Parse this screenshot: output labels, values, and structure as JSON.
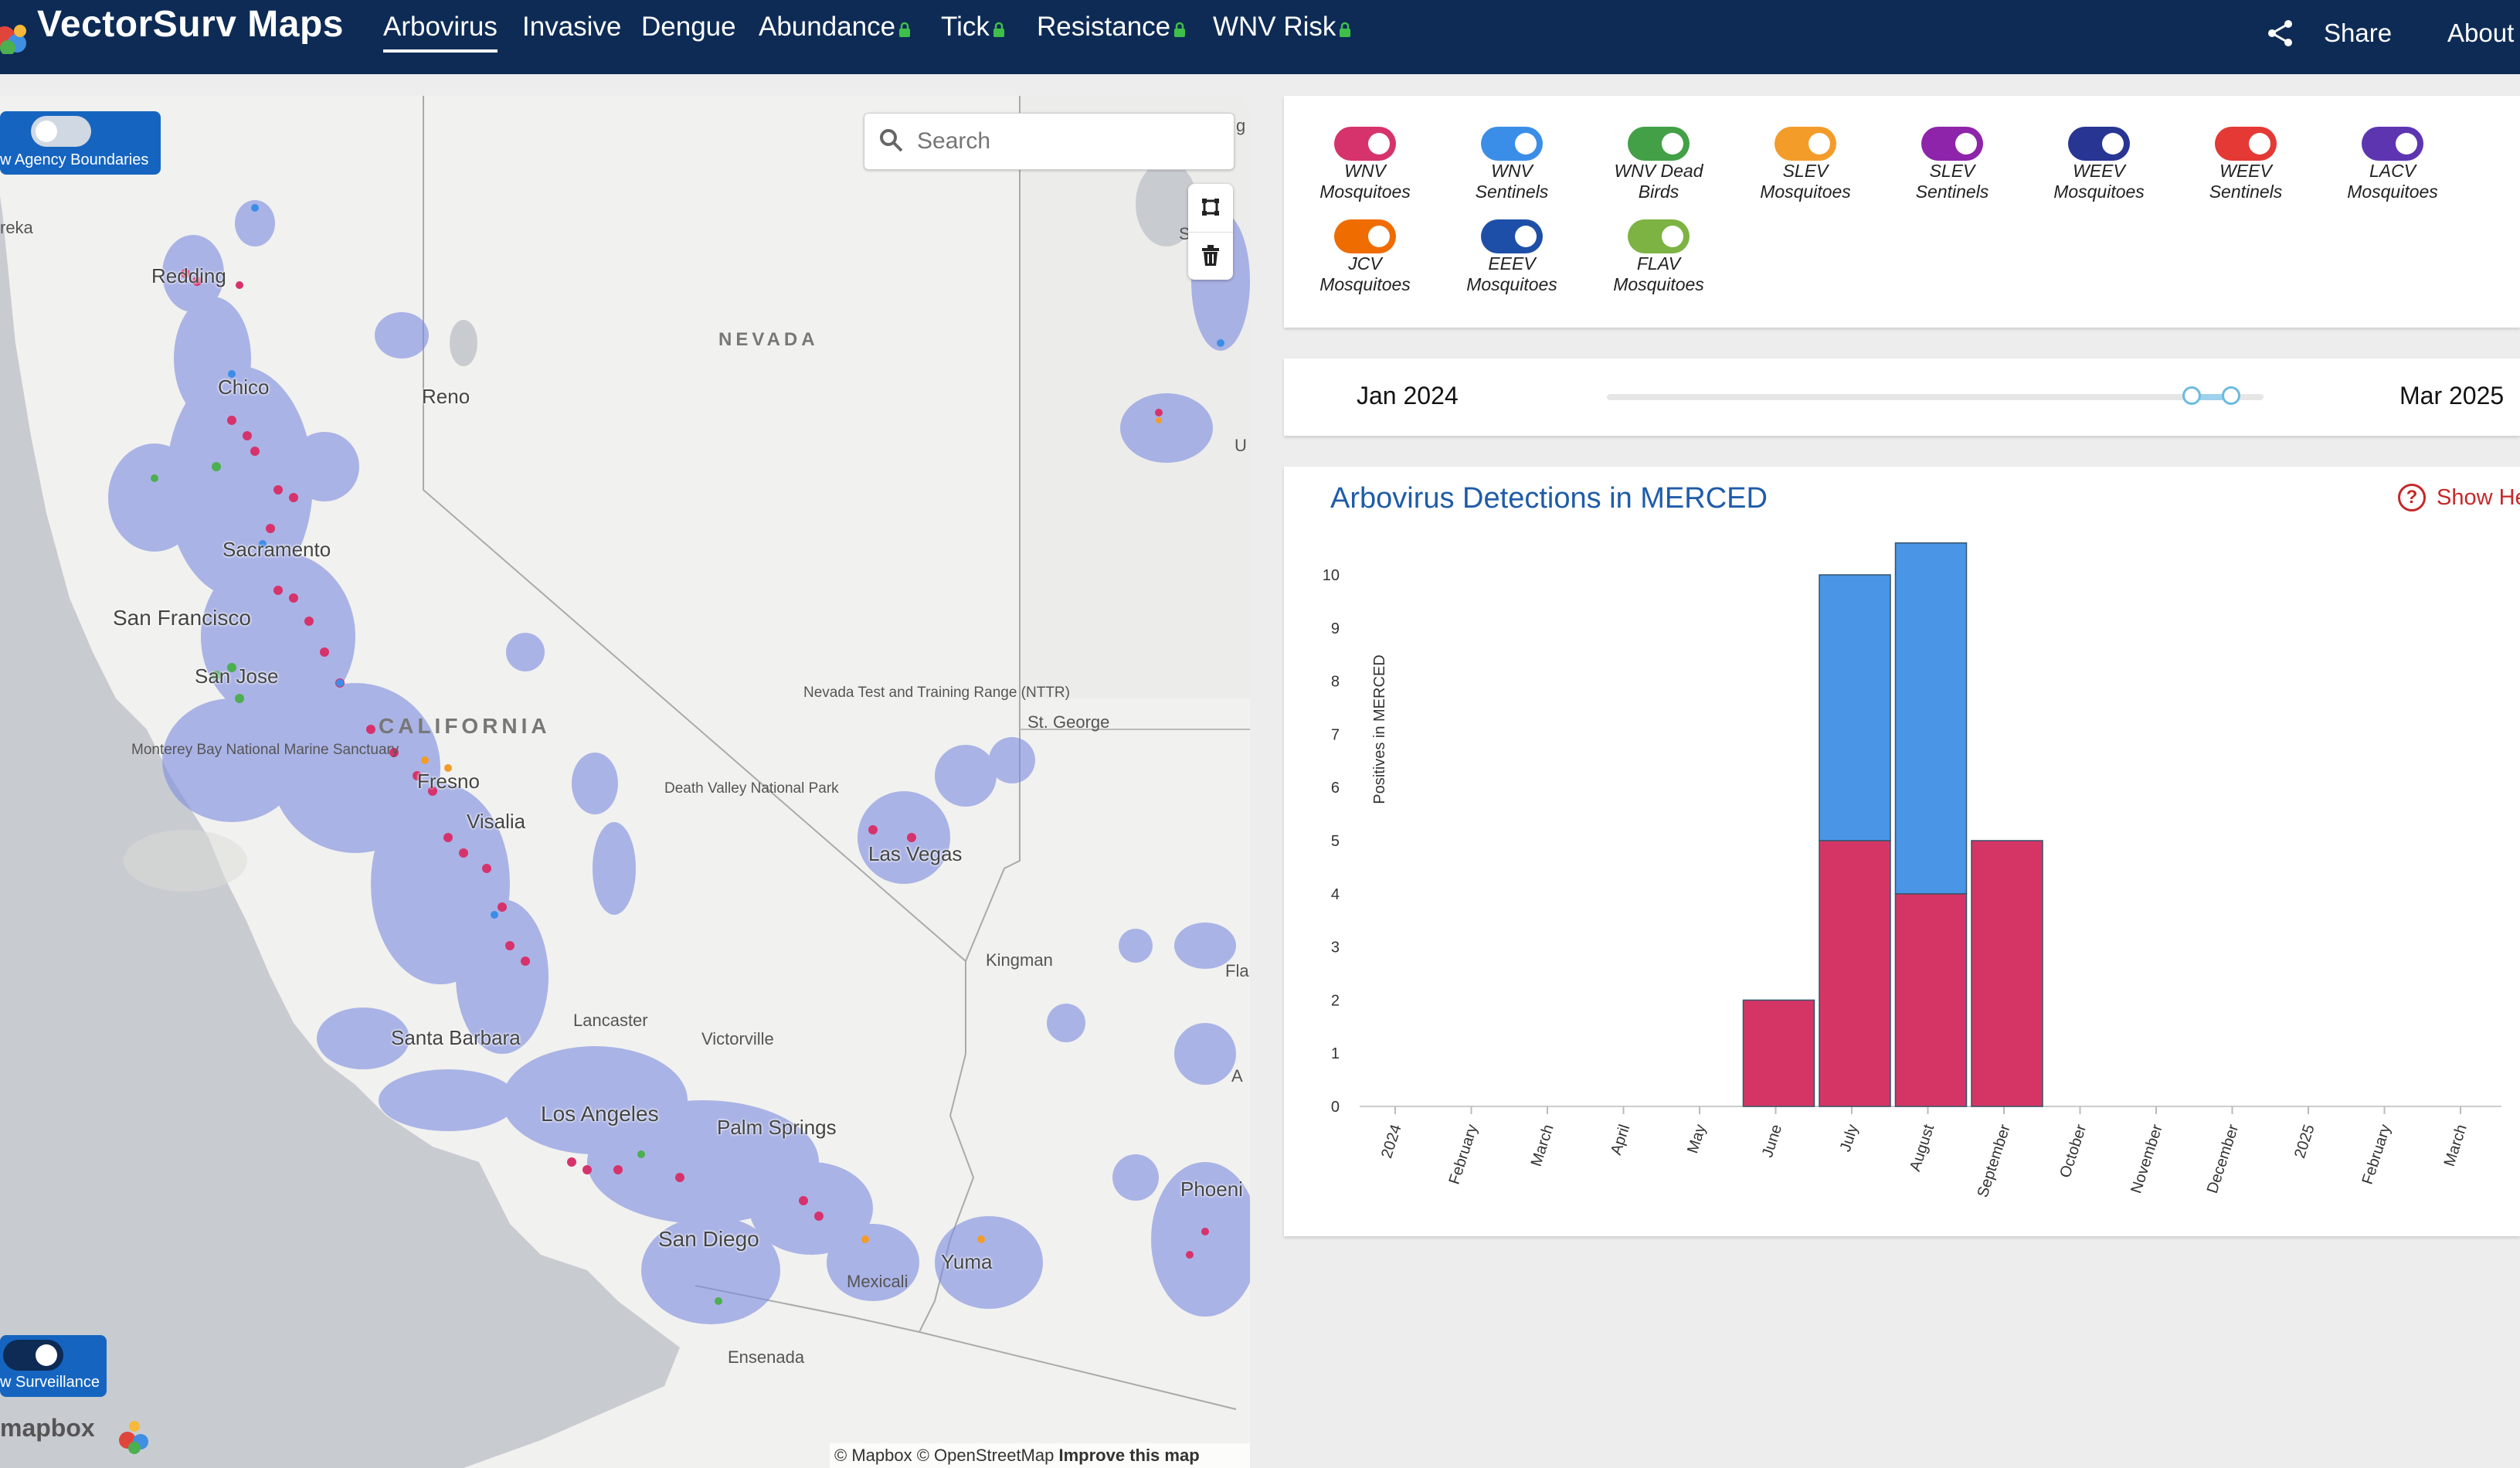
{
  "app": {
    "brand": "VectorSurv Maps",
    "nav": [
      {
        "label": "Arbovirus",
        "active": true,
        "locked": false
      },
      {
        "label": "Invasive",
        "active": false,
        "locked": false
      },
      {
        "label": "Dengue",
        "active": false,
        "locked": false
      },
      {
        "label": "Abundance",
        "active": false,
        "locked": true
      },
      {
        "label": "Tick",
        "active": false,
        "locked": true
      },
      {
        "label": "Resistance",
        "active": false,
        "locked": true
      },
      {
        "label": "WNV Risk",
        "active": false,
        "locked": true
      }
    ],
    "share_label": "Share",
    "about_label": "About",
    "colors": {
      "nav_bg": "#0d2b55",
      "accent": "#1565c0",
      "lock": "#3fbf4a"
    }
  },
  "map": {
    "search_placeholder": "Search",
    "toggle_top_label": "w Agency Boundaries",
    "toggle_bottom_label": "w Surveillance",
    "attribution": {
      "mapbox": "© Mapbox",
      "osm": "© OpenStreetMap",
      "improve": "Improve this map"
    },
    "mapbox_logo": "mapbox",
    "labels": {
      "eureka": "reka",
      "redding": "Redding",
      "chico": "Chico",
      "reno": "Reno",
      "nevada": "NEVADA",
      "sacramento": "Sacramento",
      "san_francisco": "San Francisco",
      "san_jose": "San Jose",
      "monterey": "Monterey Bay National Marine Sanctuary",
      "california": "CALIFORNIA",
      "fresno": "Fresno",
      "visalia": "Visalia",
      "nttr": "Nevada Test and Training Range (NTTR)",
      "st_george": "St. George",
      "death_valley": "Death Valley National Park",
      "las_vegas": "Las Vegas",
      "kingman": "Kingman",
      "santa_barbara": "Santa Barbara",
      "lancaster": "Lancaster",
      "victorville": "Victorville",
      "los_angeles": "Los Angeles",
      "palm_springs": "Palm Springs",
      "san_diego": "San Diego",
      "mexicali": "Mexicali",
      "yuma": "Yuma",
      "ensenada": "Ensenada",
      "phoenix": "Phoeni",
      "flag": "Fla",
      "u_edge": "U",
      "a_edge": "A",
      "g_edge": "g",
      "s_edge": "S"
    },
    "point_colors": {
      "wnv": "#d6336c",
      "sentinel": "#3b8ee8",
      "birds": "#4caf50",
      "slev": "#f39c2a",
      "heat": "#7b8be0"
    }
  },
  "legend": {
    "items": [
      {
        "line1": "WNV",
        "line2": "Mosquitoes",
        "color": "#d6336c"
      },
      {
        "line1": "WNV",
        "line2": "Sentinels",
        "color": "#3b8ee8"
      },
      {
        "line1": "WNV Dead",
        "line2": "Birds",
        "color": "#43a047"
      },
      {
        "line1": "SLEV",
        "line2": "Mosquitoes",
        "color": "#f39c2a"
      },
      {
        "line1": "SLEV",
        "line2": "Sentinels",
        "color": "#8e24aa"
      },
      {
        "line1": "WEEV",
        "line2": "Mosquitoes",
        "color": "#283593"
      },
      {
        "line1": "WEEV",
        "line2": "Sentinels",
        "color": "#e53935"
      },
      {
        "line1": "LACV",
        "line2": "Mosquitoes",
        "color": "#5e35b1"
      },
      {
        "line1": "JCV",
        "line2": "Mosquitoes",
        "color": "#ef6c00"
      },
      {
        "line1": "EEEV",
        "line2": "Mosquitoes",
        "color": "#1e4fa8"
      },
      {
        "line1": "FLAV",
        "line2": "Mosquitoes",
        "color": "#7cb342"
      }
    ]
  },
  "date_range": {
    "start": "Jan 2024",
    "end": "Mar 2025",
    "selected_start_fraction": 0.89,
    "selected_end_fraction": 0.95
  },
  "chart_panel": {
    "title": "Arbovirus Detections in MERCED",
    "help_label": "Show He"
  },
  "chart_data": {
    "type": "bar",
    "stacked": true,
    "ylabel": "Positives in MERCED",
    "ylim": [
      0,
      10
    ],
    "yticks": [
      0,
      1,
      2,
      3,
      4,
      5,
      6,
      7,
      8,
      9,
      10
    ],
    "categories": [
      "2024",
      "February",
      "March",
      "April",
      "May",
      "June",
      "July",
      "August",
      "September",
      "October",
      "November",
      "December",
      "2025",
      "February",
      "March"
    ],
    "series": [
      {
        "color": "#d53565",
        "values": [
          0,
          0,
          0,
          0,
          0,
          2,
          5,
          4,
          5,
          0,
          0,
          0,
          0,
          0,
          0
        ]
      },
      {
        "color": "#4a95e6",
        "values": [
          0,
          0,
          0,
          0,
          0,
          0,
          5,
          6.6,
          0,
          0,
          0,
          0,
          0,
          0,
          0
        ]
      }
    ]
  }
}
